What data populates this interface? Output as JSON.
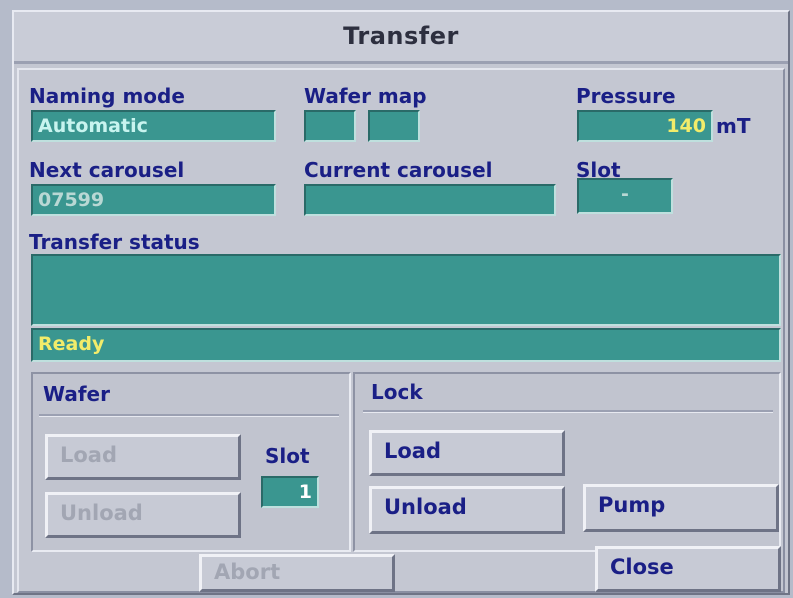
{
  "window": {
    "title": "Transfer"
  },
  "naming_mode": {
    "label": "Naming mode",
    "value": "Automatic"
  },
  "wafer_map": {
    "label": "Wafer map",
    "cell1": "",
    "cell2": ""
  },
  "pressure": {
    "label": "Pressure",
    "value": "140",
    "unit": "mT"
  },
  "next_carousel": {
    "label": "Next carousel",
    "value": "07599"
  },
  "current_carousel": {
    "label": "Current carousel",
    "value": ""
  },
  "slot": {
    "label": "Slot",
    "value": "-"
  },
  "transfer_status": {
    "label": "Transfer status",
    "value": "",
    "status_line": "Ready"
  },
  "wafer_group": {
    "title": "Wafer",
    "load_label": "Load",
    "unload_label": "Unload",
    "slot_label": "Slot",
    "slot_value": "1"
  },
  "lock_group": {
    "title": "Lock",
    "load_label": "Load",
    "unload_label": "Unload",
    "pump_label": "Pump"
  },
  "footer": {
    "abort_label": "Abort",
    "close_label": "Close"
  },
  "colors": {
    "field_teal": "#3a9690",
    "label_blue": "#1a1f86",
    "status_yellow": "#f2ec6a",
    "window_gray": "#c4c7d2"
  }
}
